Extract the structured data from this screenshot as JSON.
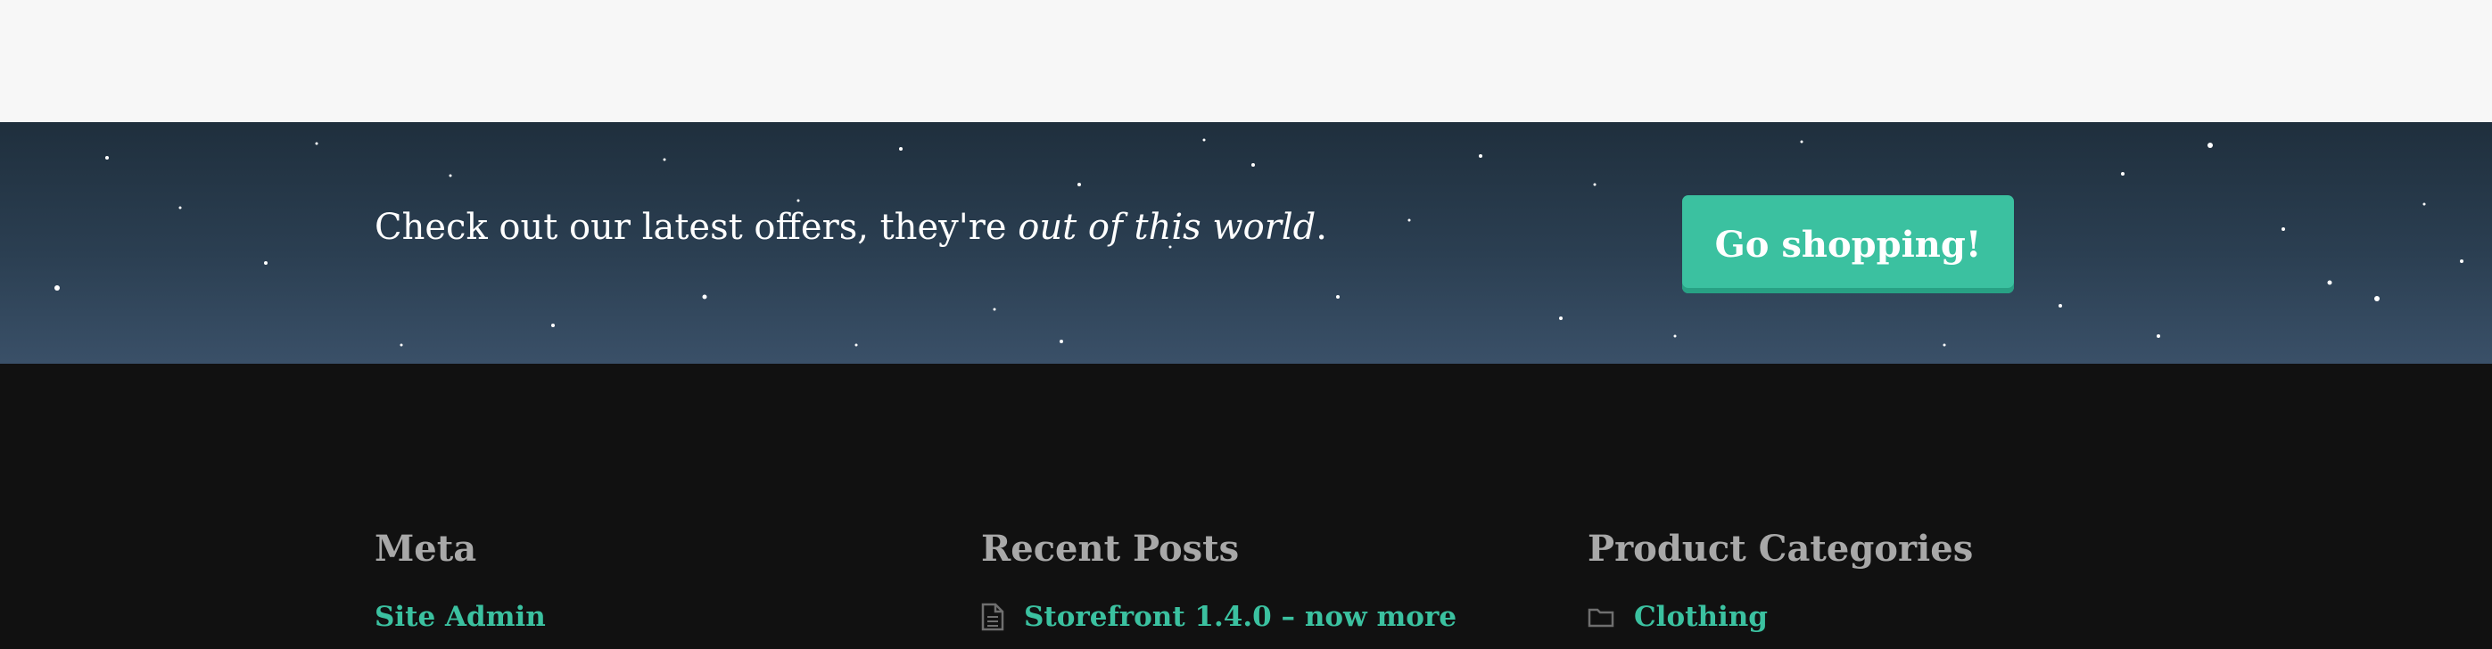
{
  "hero": {
    "text_prefix": "Check out our latest offers, they're ",
    "text_emphasis": "out of this world",
    "text_suffix": ".",
    "button_label": "Go shopping!"
  },
  "footer": {
    "meta": {
      "title": "Meta",
      "link": "Site Admin"
    },
    "recent_posts": {
      "title": "Recent Posts",
      "link": "Storefront 1.4.0 – now more",
      "icon": "document-icon"
    },
    "product_categories": {
      "title": "Product Categories",
      "link": "Clothing",
      "icon": "folder-icon"
    }
  },
  "colors": {
    "accent": "#3bc1a0",
    "footer_bg": "#111111",
    "heading": "#a8a8a8",
    "page_bg": "#f7f7f7"
  }
}
